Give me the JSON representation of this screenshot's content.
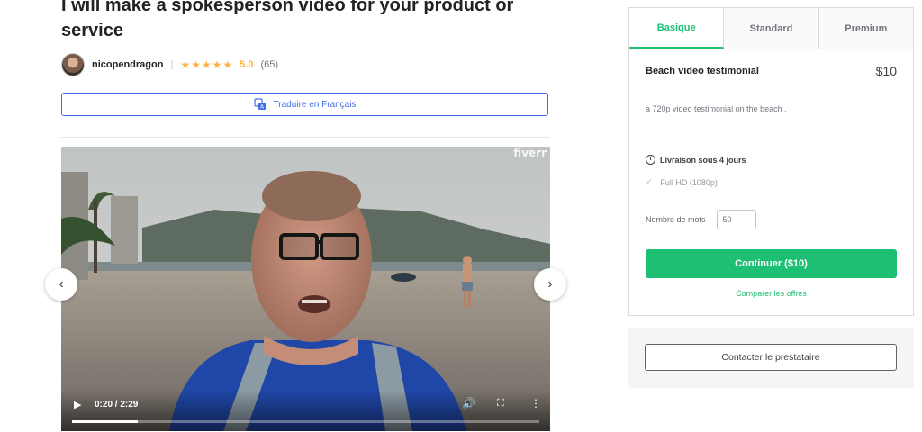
{
  "gig": {
    "title": "I will make a spokesperson video for your product or service"
  },
  "seller": {
    "name": "nicopendragon",
    "rating": "5.0",
    "review_count": "(65)",
    "stars": 5
  },
  "translate": {
    "label": "Traduire en Français",
    "icon": "translate-icon"
  },
  "video": {
    "watermark": "fiverr",
    "time": "0:20 / 2:29",
    "progress_fraction": 0.14
  },
  "packages": {
    "tabs": [
      "Basique",
      "Standard",
      "Premium"
    ],
    "active_tab": 0,
    "name": "Beach video testimonial",
    "price": "$10",
    "description": "a 720p video testimonial on the beach .",
    "delivery": "Livraison sous 4 jours",
    "features": [
      "Full HD (1080p)"
    ],
    "word_count_label": "Nombre de mots",
    "word_count_value": "50",
    "continue_label": "Continuer ($10)",
    "compare_label": "Comparer les offres",
    "accent": "#1dbf73"
  },
  "contact": {
    "label": "Contacter le prestataire"
  }
}
